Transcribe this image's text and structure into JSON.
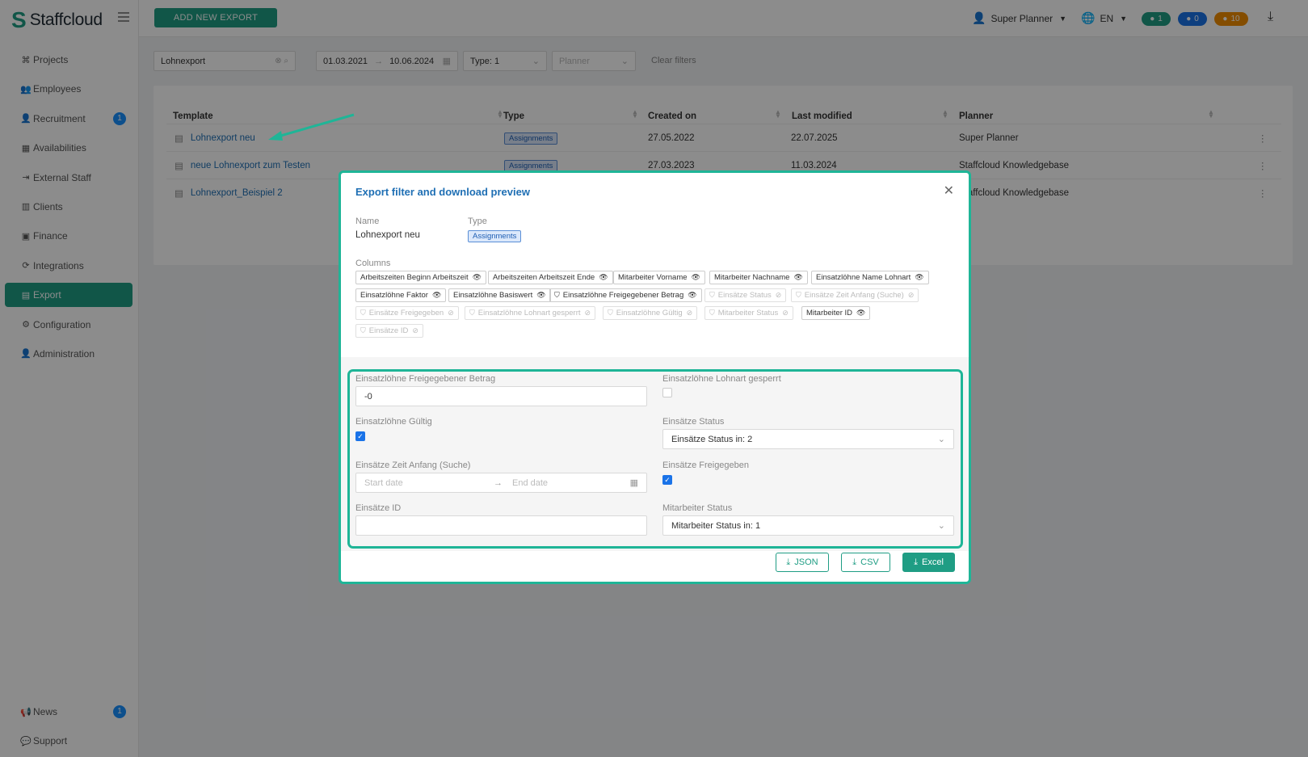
{
  "app": {
    "brand": "Staffcloud"
  },
  "topbar": {
    "add_button": "ADD NEW EXPORT",
    "user": "Super Planner",
    "lang": "EN",
    "pill_chat": "1",
    "pill_bell": "0",
    "pill_warn": "10"
  },
  "sidebar": {
    "items": [
      {
        "label": "Projects",
        "icon": "sitemap-icon"
      },
      {
        "label": "Employees",
        "icon": "users-icon"
      },
      {
        "label": "Recruitment",
        "icon": "user-plus-icon",
        "badge": "1"
      },
      {
        "label": "Availabilities",
        "icon": "calendar-icon"
      },
      {
        "label": "External Staff",
        "icon": "sign-in-icon"
      },
      {
        "label": "Clients",
        "icon": "building-icon"
      },
      {
        "label": "Finance",
        "icon": "money-icon"
      },
      {
        "label": "Integrations",
        "icon": "sync-icon"
      },
      {
        "label": "Export",
        "icon": "file-icon"
      },
      {
        "label": "Configuration",
        "icon": "cog-icon"
      },
      {
        "label": "Administration",
        "icon": "user-cog-icon"
      }
    ],
    "bottom": [
      {
        "label": "News",
        "icon": "megaphone-icon",
        "badge": "1"
      },
      {
        "label": "Support",
        "icon": "chat-icon"
      }
    ]
  },
  "filters": {
    "search": "Lohnexport",
    "date_from": "01.03.2021",
    "date_to": "10.06.2024",
    "type_label": "Type:",
    "type_value": "1",
    "planner_placeholder": "Planner",
    "clear": "Clear filters"
  },
  "table": {
    "headers": [
      "Template",
      "Type",
      "Created on",
      "Last modified",
      "Planner"
    ],
    "rows": [
      {
        "template": "Lohnexport neu",
        "type": "Assignments",
        "created": "27.05.2022",
        "modified": "22.07.2025",
        "planner": "Super Planner"
      },
      {
        "template": "neue Lohnexport zum Testen",
        "type": "Assignments",
        "created": "27.03.2023",
        "modified": "11.03.2024",
        "planner": "Staffcloud Knowledgebase"
      },
      {
        "template": "Lohnexport_Beispiel 2",
        "type": "",
        "created": "",
        "modified": "",
        "planner": "Staffcloud Knowledgebase"
      }
    ]
  },
  "modal": {
    "title": "Export filter and download preview",
    "name_label": "Name",
    "name_value": "Lohnexport neu",
    "type_label": "Type",
    "type_value": "Assignments",
    "columns_label": "Columns",
    "columns": [
      {
        "label": "Arbeitszeiten Beginn Arbeitszeit",
        "filter": false,
        "dim": false
      },
      {
        "label": "Arbeitszeiten Arbeitszeit Ende",
        "filter": false,
        "dim": false
      },
      {
        "label": "Mitarbeiter Vorname",
        "filter": false,
        "dim": false
      },
      {
        "label": "Mitarbeiter Nachname",
        "filter": false,
        "dim": false
      },
      {
        "label": "Einsatzlöhne Name Lohnart",
        "filter": false,
        "dim": false
      },
      {
        "label": "Einsatzlöhne Faktor",
        "filter": false,
        "dim": false
      },
      {
        "label": "Einsatzlöhne Basiswert",
        "filter": false,
        "dim": false
      },
      {
        "label": "Einsatzlöhne Freigegebener Betrag",
        "filter": true,
        "dim": false
      },
      {
        "label": "Einsätze Status",
        "filter": true,
        "dim": true
      },
      {
        "label": "Einsätze Zeit Anfang (Suche)",
        "filter": true,
        "dim": true
      },
      {
        "label": "Einsätze Freigegeben",
        "filter": true,
        "dim": true
      },
      {
        "label": "Einsatzlöhne Lohnart gesperrt",
        "filter": true,
        "dim": true
      },
      {
        "label": "Einsatzlöhne Gültig",
        "filter": true,
        "dim": true
      },
      {
        "label": "Mitarbeiter Status",
        "filter": true,
        "dim": true
      },
      {
        "label": "Mitarbeiter ID",
        "filter": false,
        "dim": false
      },
      {
        "label": "Einsätze ID",
        "filter": true,
        "dim": true
      }
    ],
    "fields": {
      "betrag_label": "Einsatzlöhne Freigegebener Betrag",
      "betrag_value": "-0",
      "gesperrt_label": "Einsatzlöhne Lohnart gesperrt",
      "gueltig_label": "Einsatzlöhne Gültig",
      "status_label": "Einsätze Status",
      "status_value": "Einsätze Status in:",
      "status_count": "2",
      "zeit_label": "Einsätze Zeit Anfang (Suche)",
      "zeit_start": "Start date",
      "zeit_end": "End date",
      "freigegeben_label": "Einsätze Freigegeben",
      "id_label": "Einsätze ID",
      "mstatus_label": "Mitarbeiter Status",
      "mstatus_value": "Mitarbeiter Status in:",
      "mstatus_count": "1"
    },
    "buttons": {
      "json": "JSON",
      "csv": "CSV",
      "excel": "Excel"
    }
  }
}
